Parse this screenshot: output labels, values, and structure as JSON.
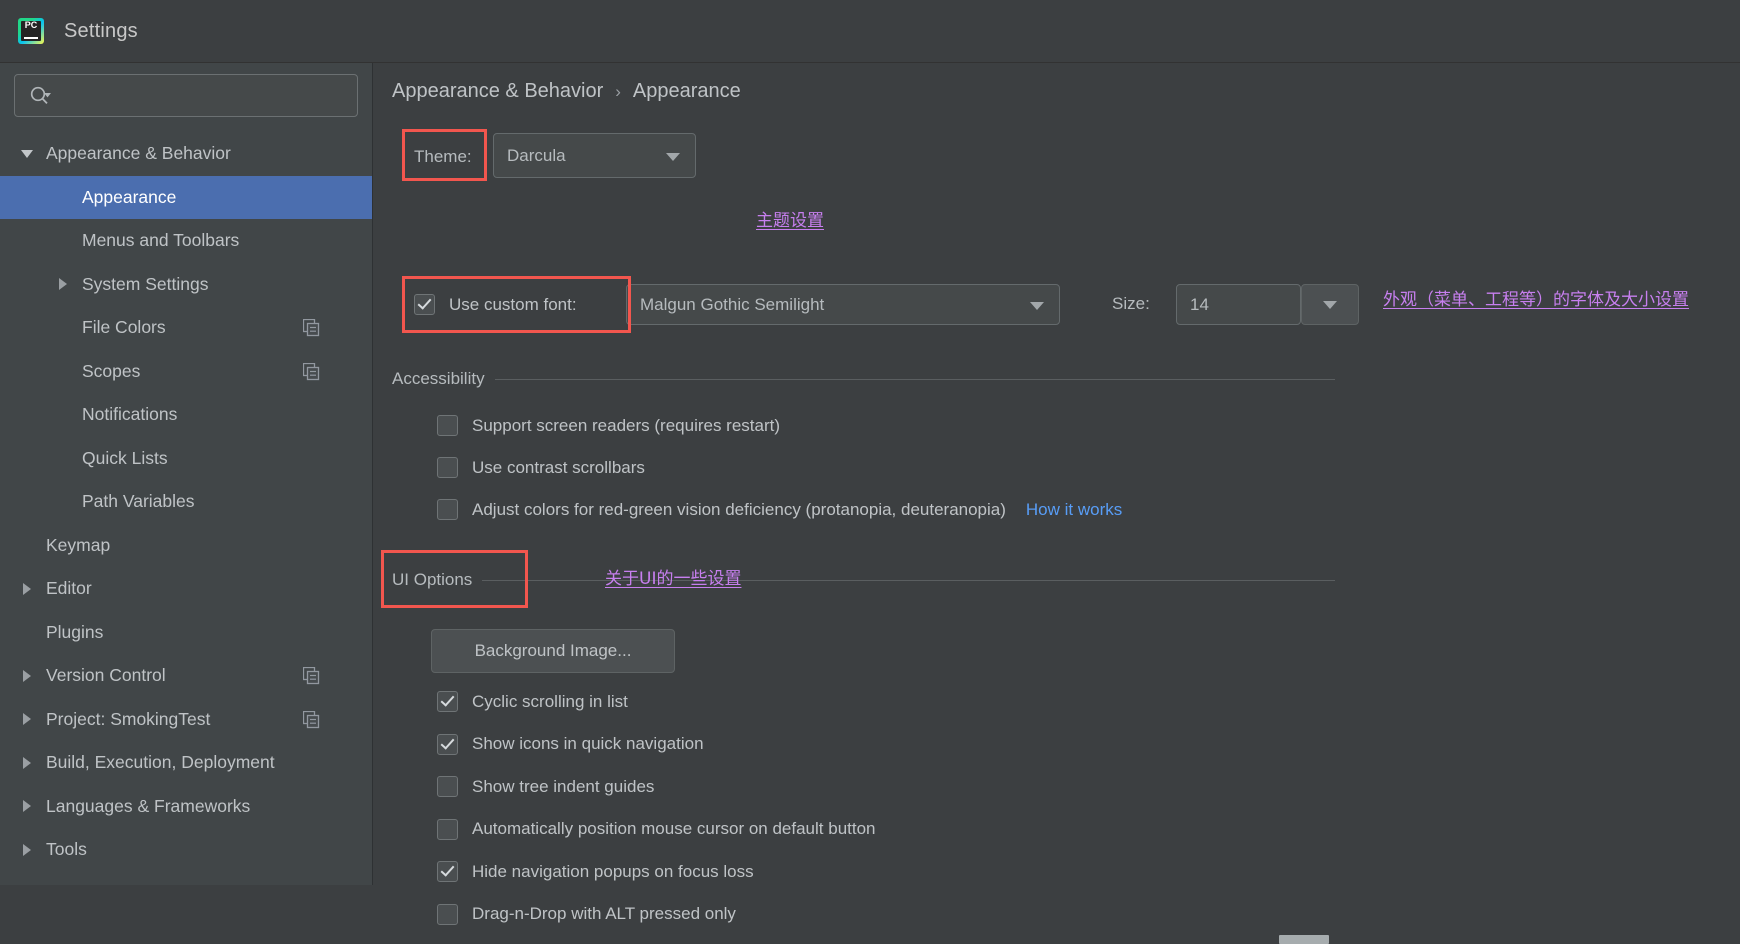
{
  "window": {
    "title": "Settings",
    "app_icon": "pycharm-icon",
    "icon_text": "PC"
  },
  "sidebar": {
    "search": {
      "value": "",
      "placeholder": "",
      "icon": "search-icon"
    },
    "items": [
      {
        "label": "Appearance & Behavior",
        "indent": 0,
        "twisty": "down",
        "selected": false,
        "copy_icon": false
      },
      {
        "label": "Appearance",
        "indent": 1,
        "twisty": "none",
        "selected": true,
        "copy_icon": false
      },
      {
        "label": "Menus and Toolbars",
        "indent": 1,
        "twisty": "none",
        "selected": false,
        "copy_icon": false
      },
      {
        "label": "System Settings",
        "indent": 1,
        "twisty": "right",
        "selected": false,
        "copy_icon": false
      },
      {
        "label": "File Colors",
        "indent": 1,
        "twisty": "none",
        "selected": false,
        "copy_icon": true
      },
      {
        "label": "Scopes",
        "indent": 1,
        "twisty": "none",
        "selected": false,
        "copy_icon": true
      },
      {
        "label": "Notifications",
        "indent": 1,
        "twisty": "none",
        "selected": false,
        "copy_icon": false
      },
      {
        "label": "Quick Lists",
        "indent": 1,
        "twisty": "none",
        "selected": false,
        "copy_icon": false
      },
      {
        "label": "Path Variables",
        "indent": 1,
        "twisty": "none",
        "selected": false,
        "copy_icon": false
      },
      {
        "label": "Keymap",
        "indent": 0,
        "twisty": "none",
        "selected": false,
        "copy_icon": false
      },
      {
        "label": "Editor",
        "indent": 0,
        "twisty": "right",
        "selected": false,
        "copy_icon": false
      },
      {
        "label": "Plugins",
        "indent": 0,
        "twisty": "none",
        "selected": false,
        "copy_icon": false
      },
      {
        "label": "Version Control",
        "indent": 0,
        "twisty": "right",
        "selected": false,
        "copy_icon": true
      },
      {
        "label": "Project: SmokingTest",
        "indent": 0,
        "twisty": "right",
        "selected": false,
        "copy_icon": true
      },
      {
        "label": "Build, Execution, Deployment",
        "indent": 0,
        "twisty": "right",
        "selected": false,
        "copy_icon": false
      },
      {
        "label": "Languages & Frameworks",
        "indent": 0,
        "twisty": "right",
        "selected": false,
        "copy_icon": false
      },
      {
        "label": "Tools",
        "indent": 0,
        "twisty": "right",
        "selected": false,
        "copy_icon": false
      }
    ]
  },
  "main": {
    "breadcrumb": {
      "parent": "Appearance & Behavior",
      "separator": "›",
      "current": "Appearance"
    },
    "theme_row": {
      "label": "Theme:",
      "value": "Darcula"
    },
    "font_row": {
      "checkbox_label": "Use custom font:",
      "checked": true,
      "font_value": "Malgun Gothic Semilight",
      "size_label": "Size:",
      "size_value": "14"
    },
    "accessibility": {
      "title": "Accessibility",
      "options": [
        {
          "label": "Support screen readers (requires restart)",
          "checked": false,
          "link": ""
        },
        {
          "label": "Use contrast scrollbars",
          "checked": false,
          "link": ""
        },
        {
          "label": "Adjust colors for red-green vision deficiency (protanopia, deuteranopia)",
          "checked": false,
          "link": "How it works"
        }
      ]
    },
    "ui_options": {
      "title": "UI Options",
      "background_image_button": "Background Image...",
      "options": [
        {
          "label": "Cyclic scrolling in list",
          "checked": true
        },
        {
          "label": "Show icons in quick navigation",
          "checked": true
        },
        {
          "label": "Show tree indent guides",
          "checked": false
        },
        {
          "label": "Automatically position mouse cursor on default button",
          "checked": false
        },
        {
          "label": "Hide navigation popups on focus loss",
          "checked": true
        },
        {
          "label": "Drag-n-Drop with ALT pressed only",
          "checked": false
        }
      ]
    }
  },
  "annotations": [
    {
      "text": "主题设置"
    },
    {
      "text": "外观（菜单、工程等）的字体及大小设置"
    },
    {
      "text": "关于UI的一些设置"
    }
  ],
  "colors": {
    "selection": "#4b6eaf",
    "annotation_red": "#f2564e",
    "annotation_purple": "#c77fef",
    "link_blue": "#589df6",
    "panel_bg": "#3c3f41",
    "sidebar_bg": "#414648"
  }
}
